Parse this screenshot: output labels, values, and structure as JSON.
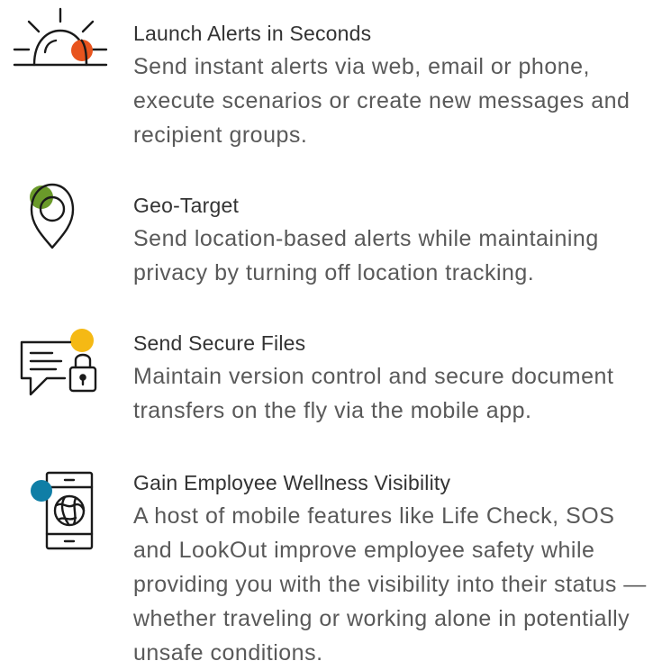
{
  "colors": {
    "alert_accent": "#e8541e",
    "geo_accent": "#6a9a2a",
    "files_accent": "#f5b914",
    "wellness_accent": "#0f7ea6",
    "icon_stroke": "#1a1a1a",
    "title_text": "#333333",
    "body_text": "#595959"
  },
  "features": [
    {
      "icon": "siren-icon",
      "title": "Launch Alerts in Seconds",
      "description": "Send instant alerts via web, email or phone, execute scenarios or create new messages and recipient groups."
    },
    {
      "icon": "map-pin-icon",
      "title": "Geo-Target",
      "description": "Send location-based alerts while maintaining privacy by turning off location tracking."
    },
    {
      "icon": "secure-message-icon",
      "title": "Send Secure Files",
      "description": "Maintain version control and secure document transfers on the fly via the mobile app."
    },
    {
      "icon": "mobile-globe-icon",
      "title": "Gain Employee Wellness Visibility",
      "description": "A host of mobile features like Life Check, SOS and LookOut improve employee safety while providing you with the visibility into their status — whether traveling or working alone in potentially unsafe conditions."
    }
  ]
}
